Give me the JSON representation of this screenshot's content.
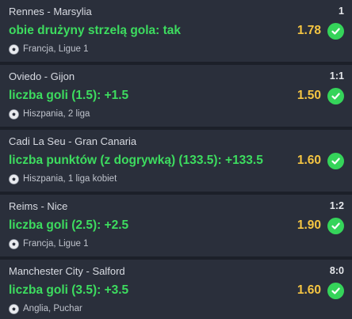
{
  "bets": [
    {
      "match": "Rennes - Marsylia",
      "score": "1",
      "pick": "obie drużyny strzelą gola: tak",
      "odds": "1.78",
      "league": "Francja, Ligue 1",
      "status": "won"
    },
    {
      "match": "Oviedo - Gijon",
      "score": "1:1",
      "pick": "liczba goli (1.5): +1.5",
      "odds": "1.50",
      "league": "Hiszpania, 2 liga",
      "status": "won"
    },
    {
      "match": "Cadi La Seu - Gran Canaria",
      "score": "",
      "pick": "liczba punktów (z dogrywką) (133.5): +133.5",
      "odds": "1.60",
      "league": "Hiszpania, 1 liga kobiet",
      "status": "won"
    },
    {
      "match": "Reims - Nice",
      "score": "1:2",
      "pick": "liczba goli (2.5): +2.5",
      "odds": "1.90",
      "league": "Francja, Ligue 1",
      "status": "won"
    },
    {
      "match": "Manchester City - Salford",
      "score": "8:0",
      "pick": "liczba goli (3.5): +3.5",
      "odds": "1.60",
      "league": "Anglia, Puchar",
      "status": "won"
    }
  ],
  "colors": {
    "background": "#1c2029",
    "card": "#2a2f3b",
    "pick_green": "#3ddc5f",
    "odds_yellow": "#f5c542",
    "check_green": "#35d45a"
  },
  "icons": {
    "sport": "soccer-ball-icon",
    "status": "check-circle-icon"
  }
}
